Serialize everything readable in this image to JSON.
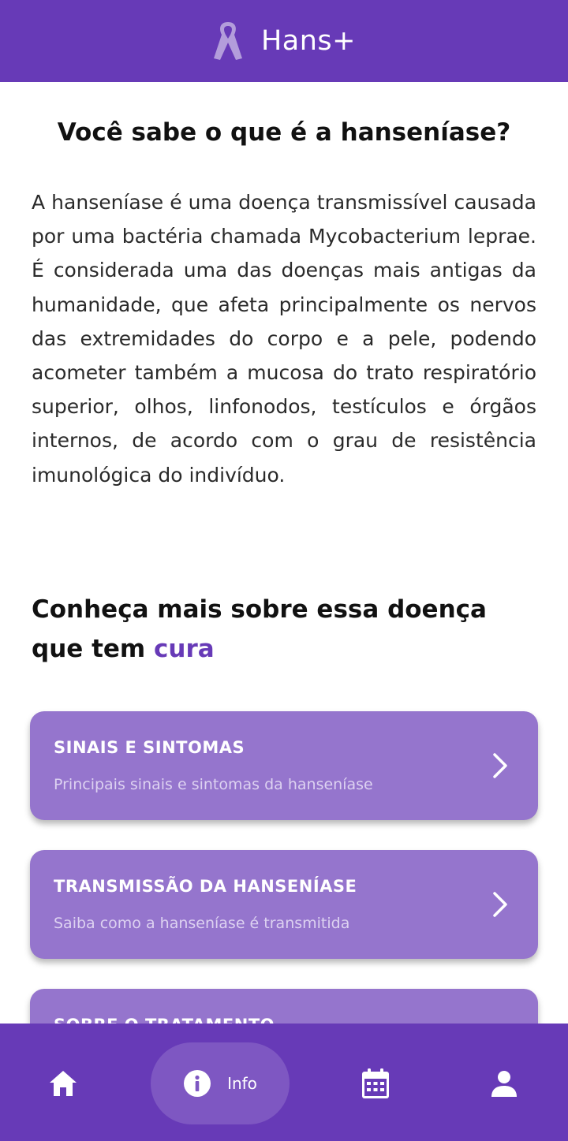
{
  "app": {
    "title": "Hans+",
    "colors": {
      "primary": "#673ab7",
      "card": "#9575cd",
      "ribbon": "#b39ddb"
    },
    "logo_icon": "ribbon-icon"
  },
  "main": {
    "question": "Você sabe o que é a hanseníase?",
    "intro": "A hanseníase é uma doença transmissível causada por uma bactéria chamada Mycobacterium leprae. É considerada uma das doenças mais antigas da humanidade, que afeta principalmente os nervos das extremidades do corpo e a pele, podendo acometer também a mucosa do trato respiratório superior, olhos, linfonodos, testículos e órgãos internos, de acordo com o grau de resistência imunológica do indivíduo.",
    "section_title": "Conheça mais sobre essa doença que tem",
    "section_accent": "cura"
  },
  "cards": [
    {
      "title": "SINAIS E SINTOMAS",
      "subtitle": "Principais sinais e sintomas da hanseníase",
      "icon": "chevron-right-icon"
    },
    {
      "title": "TRANSMISSÃO DA HANSENÍASE",
      "subtitle": "Saiba como a hanseníase é transmitida",
      "icon": "chevron-right-icon"
    },
    {
      "title": "SOBRE O TRATAMENTO",
      "subtitle": "",
      "icon": "chevron-right-icon"
    }
  ],
  "bottom_nav": {
    "items": [
      {
        "icon": "home-icon"
      },
      {
        "icon": "info-icon",
        "label": "Info",
        "active": true
      },
      {
        "icon": "calendar-icon"
      },
      {
        "icon": "person-icon"
      }
    ]
  }
}
